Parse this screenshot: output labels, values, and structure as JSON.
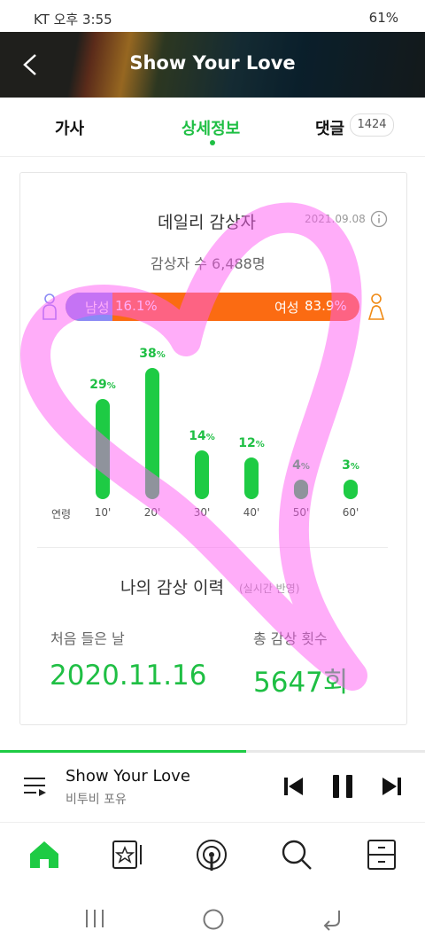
{
  "status_bar": {
    "left": "KT 오후 3:55",
    "right": "61%"
  },
  "header": {
    "title": "Show Your Love"
  },
  "tabs": [
    {
      "label": "가사"
    },
    {
      "label": "상세정보"
    },
    {
      "label": "댓글",
      "count": "1424"
    }
  ],
  "daily": {
    "title": "데일리 감상자",
    "date": "2021.09.08",
    "listeners": "감상자 수 6,488명",
    "male_label": "남성",
    "male_pct": "16.1%",
    "male_value": 16.1,
    "female_label": "여성",
    "female_pct": "83.9%",
    "female_value": 83.9,
    "age_axis_label": "연령"
  },
  "chart_data": {
    "type": "bar",
    "categories": [
      "10'",
      "20'",
      "30'",
      "40'",
      "50'",
      "60'"
    ],
    "values": [
      29,
      38,
      14,
      12,
      4,
      3
    ],
    "value_suffix": "%"
  },
  "history": {
    "title": "나의 감상 이력",
    "subtitle": "(실시간 반영)",
    "first_listen_label": "처음 들은 날",
    "first_listen_value": "2020.11.16",
    "total_count_label": "총 감상 횟수",
    "total_count_value": "5647회"
  },
  "player": {
    "track": "Show Your Love",
    "artist": "비투비 포유",
    "progress": 0.58
  },
  "colors": {
    "accent": "#1ecb44",
    "male": "#8b8af5",
    "female": "#fb6b12",
    "overlay": "#ff5cf4"
  }
}
